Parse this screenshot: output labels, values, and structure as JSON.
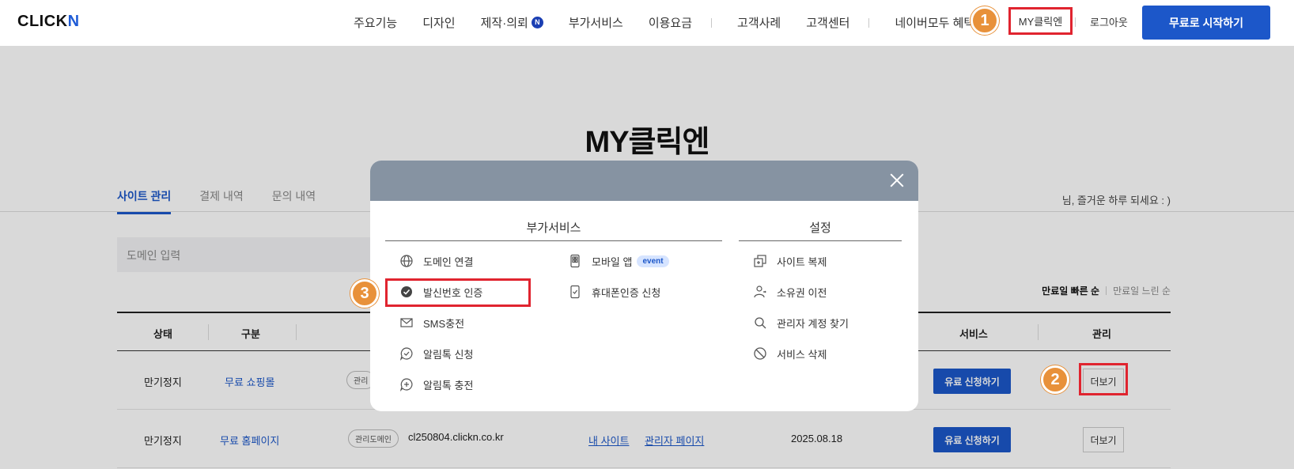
{
  "header": {
    "logo_text": "CLICK",
    "logo_accent": "N",
    "nav": [
      {
        "label": "주요기능",
        "badge": ""
      },
      {
        "label": "디자인",
        "badge": ""
      },
      {
        "label": "제작·의뢰",
        "badge": "N"
      },
      {
        "label": "부가서비스",
        "badge": ""
      },
      {
        "label": "이용요금",
        "badge": ""
      },
      {
        "label": "고객사례",
        "badge": ""
      },
      {
        "label": "고객센터",
        "badge": ""
      },
      {
        "label": "네이버모두 혜택",
        "badge": "N"
      }
    ],
    "my_link": "MY클릭엔",
    "logout": "로그아웃",
    "start_button": "무료로 시작하기"
  },
  "page": {
    "title": "MY클릭엔",
    "tabs": [
      "사이트 관리",
      "결제 내역",
      "문의 내역"
    ],
    "active_tab": "사이트 관리",
    "greeting": "님, 즐거운 하루 되세요 : )",
    "search_placeholder": "도메인 입력",
    "sort": {
      "selected": "만료일 빠른 순",
      "other": "만료일 느린 순"
    }
  },
  "table": {
    "headers": {
      "status": "상태",
      "type": "구분",
      "service": "서비스",
      "manage": "관리"
    },
    "rows": [
      {
        "status": "만기정지",
        "type": "무료 쇼핑몰",
        "tag": "관리",
        "domain": "",
        "link1": "",
        "link2": "",
        "date": "",
        "pay_label": "유료 신청하기",
        "more_label": "더보기"
      },
      {
        "status": "만기정지",
        "type": "무료 홈페이지",
        "tag": "관리도메인",
        "domain": "cl250804.clickn.co.kr",
        "link1": "내 사이트",
        "link2": "관리자 페이지",
        "date": "2025.08.18",
        "pay_label": "유료 신청하기",
        "more_label": "더보기"
      }
    ]
  },
  "modal": {
    "section_addon": "부가서비스",
    "section_settings": "설정",
    "addon_col1": [
      {
        "label": "도메인 연결",
        "icon": "globe-icon"
      },
      {
        "label": "발신번호 인증",
        "icon": "check-badge-icon"
      },
      {
        "label": "SMS충전",
        "icon": "mail-icon"
      },
      {
        "label": "알림톡 신청",
        "icon": "chat-check-icon"
      },
      {
        "label": "알림톡 충전",
        "icon": "chat-plus-icon"
      }
    ],
    "addon_col2": [
      {
        "label": "모바일 앱",
        "icon": "mobile-app-icon",
        "badge": "event"
      },
      {
        "label": "휴대폰인증 신청",
        "icon": "phone-verify-icon",
        "badge": ""
      }
    ],
    "settings": [
      {
        "label": "사이트 복제",
        "icon": "copy-icon"
      },
      {
        "label": "소유권 이전",
        "icon": "user-transfer-icon"
      },
      {
        "label": "관리자 계정 찾기",
        "icon": "search-icon"
      },
      {
        "label": "서비스 삭제",
        "icon": "ban-icon"
      }
    ]
  },
  "steps": [
    "1",
    "2",
    "3"
  ]
}
